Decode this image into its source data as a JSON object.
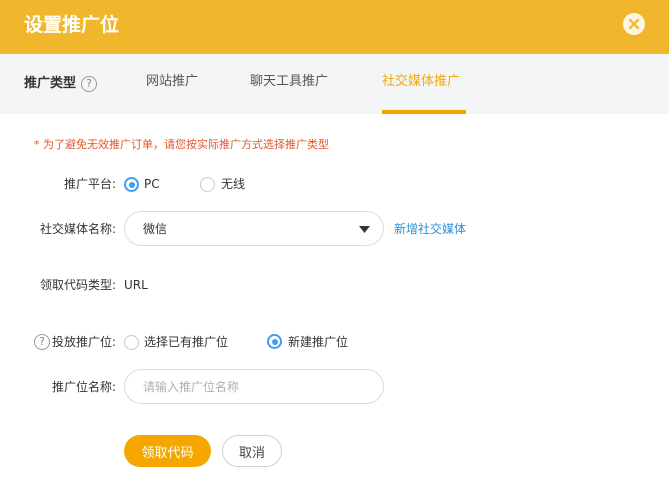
{
  "header": {
    "title": "设置推广位"
  },
  "tabs": {
    "type_label": "推广类型",
    "help_glyph": "?",
    "items": [
      {
        "label": "网站推广",
        "active": false
      },
      {
        "label": "聊天工具推广",
        "active": false
      },
      {
        "label": "社交媒体推广",
        "active": true
      }
    ]
  },
  "notice": "* 为了避免无效推广订单，请您按实际推广方式选择推广类型",
  "form": {
    "platform": {
      "label": "推广平台:",
      "options": [
        {
          "label": "PC",
          "checked": true
        },
        {
          "label": "无线",
          "checked": false
        }
      ]
    },
    "media": {
      "label": "社交媒体名称:",
      "selected": "微信",
      "add_link": "新增社交媒体"
    },
    "code_type": {
      "label": "领取代码类型:",
      "value": "URL"
    },
    "placement": {
      "label": "投放推广位:",
      "help_glyph": "?",
      "options": [
        {
          "label": "选择已有推广位",
          "checked": false
        },
        {
          "label": "新建推广位",
          "checked": true
        }
      ]
    },
    "placement_name": {
      "label": "推广位名称:",
      "placeholder": "请输入推广位名称",
      "value": ""
    }
  },
  "buttons": {
    "submit": "领取代码",
    "cancel": "取消"
  },
  "colors": {
    "header": "#f0b62c",
    "accent": "#f5a700",
    "link": "#2e8fd8",
    "notice": "#e1572e",
    "radio": "#3d9ef5"
  }
}
